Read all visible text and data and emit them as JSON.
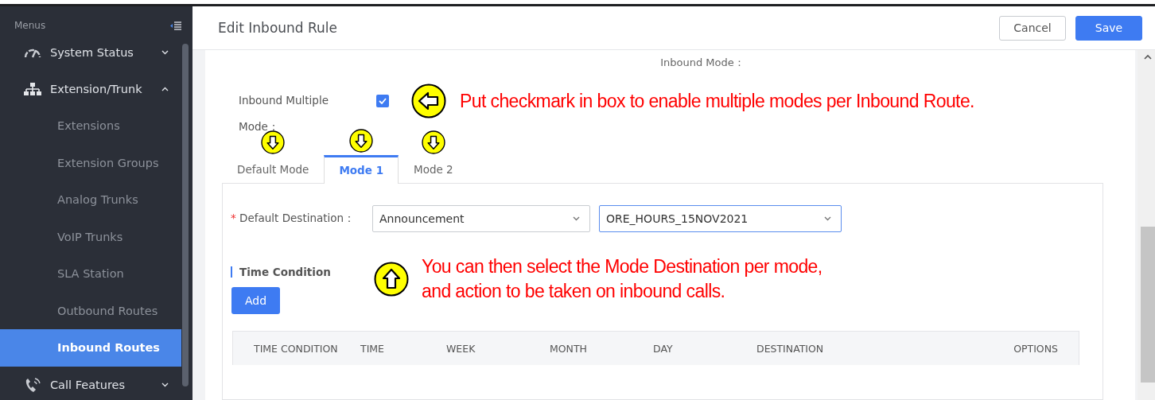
{
  "sidebar": {
    "title": "Menus",
    "items": [
      {
        "label": "System Status",
        "expanded": false
      },
      {
        "label": "Extension/Trunk",
        "expanded": true,
        "children": [
          {
            "label": "Extensions",
            "selected": false
          },
          {
            "label": "Extension Groups",
            "selected": false
          },
          {
            "label": "Analog Trunks",
            "selected": false
          },
          {
            "label": "VoIP Trunks",
            "selected": false
          },
          {
            "label": "SLA Station",
            "selected": false
          },
          {
            "label": "Outbound Routes",
            "selected": false
          },
          {
            "label": "Inbound Routes",
            "selected": true
          }
        ]
      },
      {
        "label": "Call Features",
        "expanded": false
      }
    ]
  },
  "header": {
    "title": "Edit Inbound Rule",
    "buttons": [
      {
        "label": "Cancel",
        "kind": "secondary"
      },
      {
        "label": "Save",
        "kind": "primary"
      }
    ]
  },
  "form": {
    "inbound_mode_label": "Inbound Mode：",
    "multiple_mode": {
      "label": "Inbound Multiple Mode：",
      "checked": true,
      "note": "Put checkmark in box to enable multiple modes per Inbound Route."
    },
    "tabs": [
      {
        "label": "Default Mode",
        "selected": false,
        "pointer": true
      },
      {
        "label": "Mode 1",
        "selected": true,
        "pointer": true
      },
      {
        "label": "Mode 2",
        "selected": false,
        "pointer": true
      }
    ],
    "default_destination": {
      "label": "Default Destination：",
      "required_mark": "*",
      "selects": [
        {
          "value": "Announcement",
          "focused": false
        },
        {
          "value": "ORE_HOURS_15NOV2021",
          "focused": true
        }
      ]
    },
    "time_condition": {
      "title": "Time Condition",
      "note_lines": [
        "You can then select the Mode Destination per mode,",
        "and action to be taken on inbound calls."
      ],
      "add_button": "Add",
      "columns": [
        "TIME CONDITION",
        "TIME",
        "WEEK",
        "MONTH",
        "DAY",
        "DESTINATION",
        "OPTIONS"
      ]
    }
  }
}
